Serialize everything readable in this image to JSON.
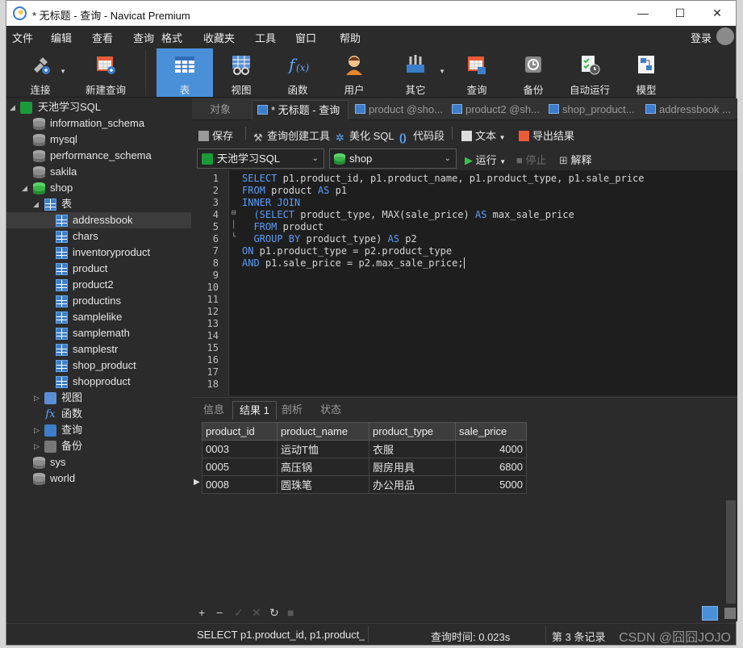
{
  "window": {
    "title": "* 无标题 - 查询 - Navicat Premium",
    "controls": [
      "—",
      "☐",
      "✕"
    ]
  },
  "menu": {
    "items": [
      "文件",
      "编辑",
      "查看",
      "查询",
      "格式",
      "收藏夹",
      "工具",
      "窗口",
      "帮助"
    ],
    "login": "登录"
  },
  "toolbar": {
    "items": [
      {
        "label": "连接",
        "icon": "connection-plug-icon"
      },
      {
        "label": "新建查询",
        "icon": "new-query-icon"
      },
      {
        "label": "表",
        "icon": "table-icon",
        "active": true
      },
      {
        "label": "视图",
        "icon": "view-icon"
      },
      {
        "label": "函数",
        "icon": "function-icon"
      },
      {
        "label": "用户",
        "icon": "user-icon"
      },
      {
        "label": "其它",
        "icon": "other-tools-icon"
      },
      {
        "label": "查询",
        "icon": "query-icon"
      },
      {
        "label": "备份",
        "icon": "backup-icon"
      },
      {
        "label": "自动运行",
        "icon": "auto-run-icon"
      },
      {
        "label": "模型",
        "icon": "model-icon"
      }
    ]
  },
  "navigator": {
    "connection": "天池学习SQL",
    "databases_top": [
      "information_schema",
      "mysql",
      "performance_schema",
      "sakila"
    ],
    "active_db": "shop",
    "tables_folder": "表",
    "tables": [
      "addressbook",
      "chars",
      "inventoryproduct",
      "product",
      "product2",
      "productins",
      "samplelike",
      "samplemath",
      "samplestr",
      "shop_product",
      "shopproduct"
    ],
    "selected_table": "addressbook",
    "folders": [
      "视图",
      "函数",
      "查询",
      "备份"
    ],
    "databases_bottom": [
      "sys",
      "world"
    ]
  },
  "tabs": {
    "objects": "对象",
    "items": [
      "* 无标题 - 查询",
      "product @sho...",
      "product2 @sh...",
      "shop_product...",
      "addressbook ..."
    ]
  },
  "query_toolbar": {
    "save": "保存",
    "builder": "查询创建工具",
    "beautify": "美化 SQL",
    "snippet": "代码段",
    "text": "文本",
    "export": "导出结果"
  },
  "selectors": {
    "connection": "天池学习SQL",
    "database": "shop",
    "run": "运行",
    "stop": "停止",
    "explain": "解释"
  },
  "editor": {
    "line_numbers": [
      "1",
      "2",
      "3",
      "4",
      "5",
      "6",
      "7",
      "8",
      "9",
      "10",
      "11",
      "12",
      "13",
      "14",
      "15",
      "16",
      "17",
      "18"
    ],
    "lines": [
      [
        {
          "t": "SELECT",
          "k": true
        },
        {
          "t": " p1.product_id, p1.product_name, p1.product_type, p1.sale_price"
        }
      ],
      [
        {
          "t": "FROM",
          "k": true
        },
        {
          "t": " product "
        },
        {
          "t": "AS",
          "k": true
        },
        {
          "t": " p1"
        }
      ],
      [
        {
          "t": "INNER JOIN",
          "k": true
        }
      ],
      [
        {
          "t": "  (SELECT",
          "k": true
        },
        {
          "t": " product_type, MAX(sale_price) "
        },
        {
          "t": "AS",
          "k": true
        },
        {
          "t": " max_sale_price"
        }
      ],
      [
        {
          "t": "  FROM",
          "k": true
        },
        {
          "t": " product"
        }
      ],
      [
        {
          "t": "  GROUP BY",
          "k": true
        },
        {
          "t": " product_type) "
        },
        {
          "t": "AS",
          "k": true
        },
        {
          "t": " p2"
        }
      ],
      [
        {
          "t": "ON",
          "k": true
        },
        {
          "t": " p1.product_type = p2.product_type"
        }
      ],
      [
        {
          "t": "AND",
          "k": true
        },
        {
          "t": " p1.sale_price = p2.max_sale_price;"
        }
      ]
    ]
  },
  "result_tabs": [
    "信息",
    "结果 1",
    "剖析",
    "状态"
  ],
  "result": {
    "columns": [
      "product_id",
      "product_name",
      "product_type",
      "sale_price"
    ],
    "rows": [
      [
        "0003",
        "运动T恤",
        "衣服",
        "4000"
      ],
      [
        "0005",
        "高压锅",
        "厨房用具",
        "6800"
      ],
      [
        "0008",
        "圆珠笔",
        "办公用品",
        "5000"
      ]
    ]
  },
  "grid_toolbar": [
    "+",
    "−",
    "✓",
    "✕",
    "↻",
    "■"
  ],
  "status": {
    "sql": "SELECT p1.product_id, p1.product_",
    "query_time": "查询时间: 0.023s",
    "records": "第 3 条记录",
    "watermark": "CSDN @囧囧JOJO"
  }
}
